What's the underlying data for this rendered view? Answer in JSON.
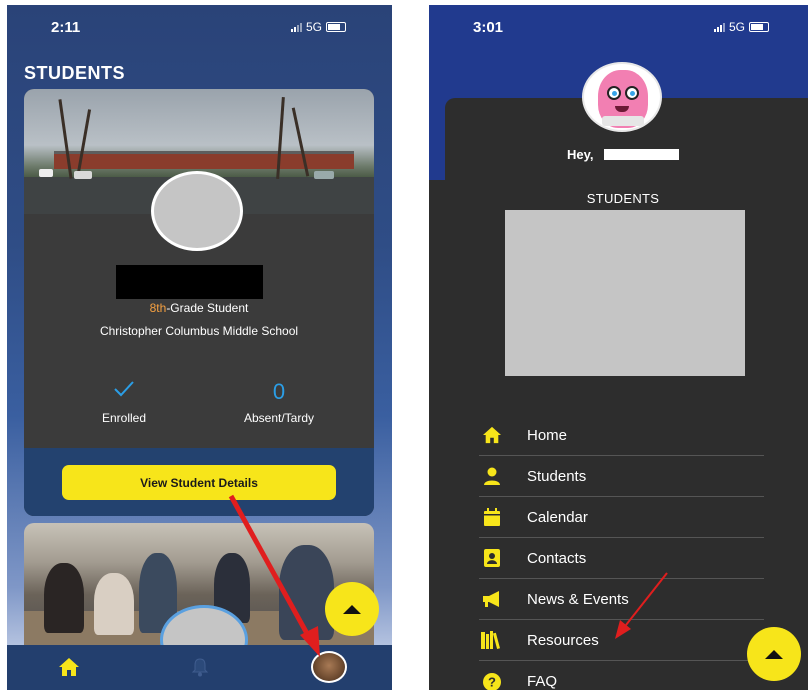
{
  "left_screen": {
    "status_time": "2:11",
    "status_network": "5G",
    "page_title": "STUDENTS",
    "student_card": {
      "grade_highlight": "8th",
      "grade_rest": "-Grade Student",
      "school": "Christopher Columbus Middle School",
      "enrollment_status": "Enrolled",
      "absent_tardy_count": "0",
      "absent_tardy_label": "Absent/Tardy",
      "details_button": "View Student Details"
    },
    "bottom_nav": [
      "home-icon",
      "bell-icon",
      "profile-avatar"
    ]
  },
  "right_screen": {
    "status_time": "3:01",
    "status_network": "5G",
    "greeting": "Hey,",
    "section_title": "STUDENTS",
    "menu": [
      {
        "label": "Home",
        "icon": "home-icon"
      },
      {
        "label": "Students",
        "icon": "person-icon"
      },
      {
        "label": "Calendar",
        "icon": "calendar-icon"
      },
      {
        "label": "Contacts",
        "icon": "contact-card-icon"
      },
      {
        "label": "News & Events",
        "icon": "megaphone-icon"
      },
      {
        "label": "Resources",
        "icon": "books-icon"
      },
      {
        "label": "FAQ",
        "icon": "question-icon"
      }
    ]
  },
  "colors": {
    "accent_yellow": "#f7e51a",
    "nav_blue": "#233f6e",
    "check_blue": "#2b9ee6",
    "grade_orange": "#f5a040",
    "annotation_red": "#e01e1e"
  }
}
